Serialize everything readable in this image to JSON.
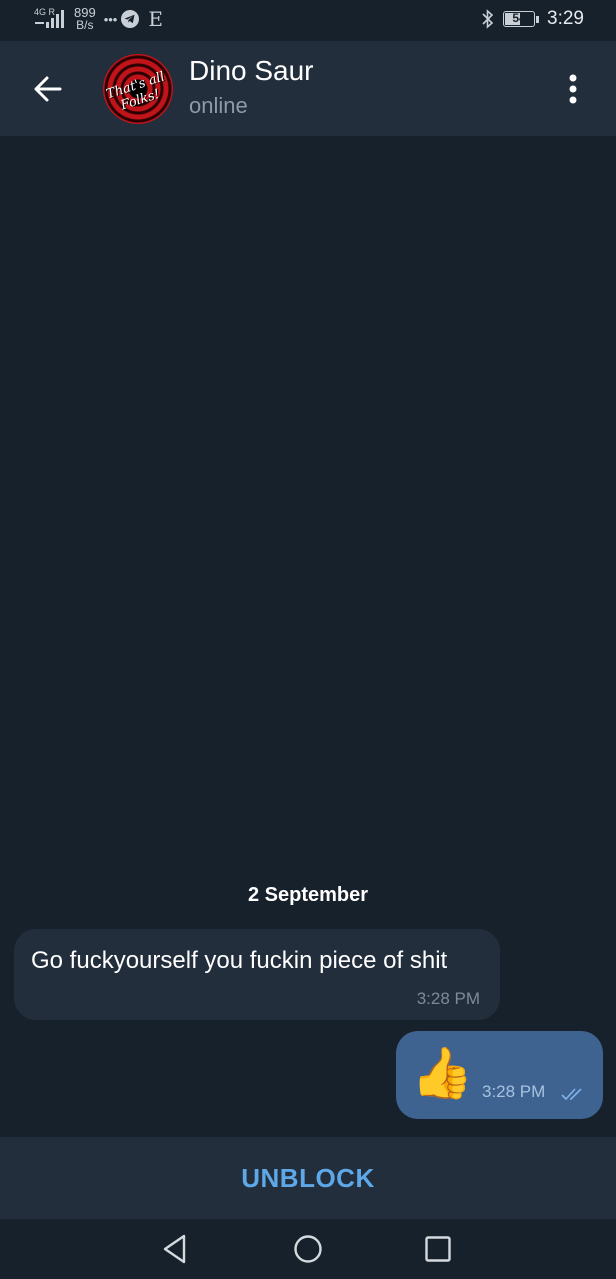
{
  "status_bar": {
    "network_gen": "4G R",
    "net_speed_value": "899",
    "net_speed_unit": "B/s",
    "dots": "•••",
    "carrier_icon_letter": "E",
    "battery": "54",
    "battery_level": 0.54,
    "time": "3:29"
  },
  "header": {
    "contact_name": "Dino Saur",
    "status": "online",
    "avatar_text": "That's all Folks!"
  },
  "chat": {
    "date_separator": "2 September",
    "messages": [
      {
        "direction": "incoming",
        "text": "Go fuckyourself you fuckin piece of shit",
        "time": "3:28 PM"
      },
      {
        "direction": "outgoing",
        "text": "👍",
        "time": "3:28 PM",
        "read": true
      }
    ]
  },
  "bottom_bar": {
    "action_label": "UNBLOCK"
  },
  "colors": {
    "background": "#17212b",
    "header": "#232e3c",
    "incoming_bubble": "#232e3c",
    "outgoing_bubble": "#3f6390",
    "accent": "#5ea8e8"
  }
}
